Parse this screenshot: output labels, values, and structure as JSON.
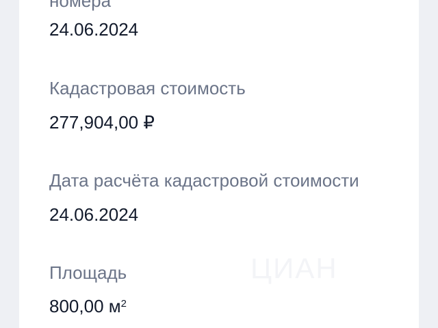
{
  "fields": [
    {
      "label": "номера",
      "value": "24.06.2024"
    },
    {
      "label": "Кадастровая стоимость",
      "value": "277,904,00 ₽"
    },
    {
      "label": "Дата расчёта кадастровой стоимости",
      "value": "24.06.2024"
    },
    {
      "label": "Площадь",
      "value": "800,00 м",
      "unit_superscript": "2"
    }
  ],
  "watermark": "ЦИАН"
}
